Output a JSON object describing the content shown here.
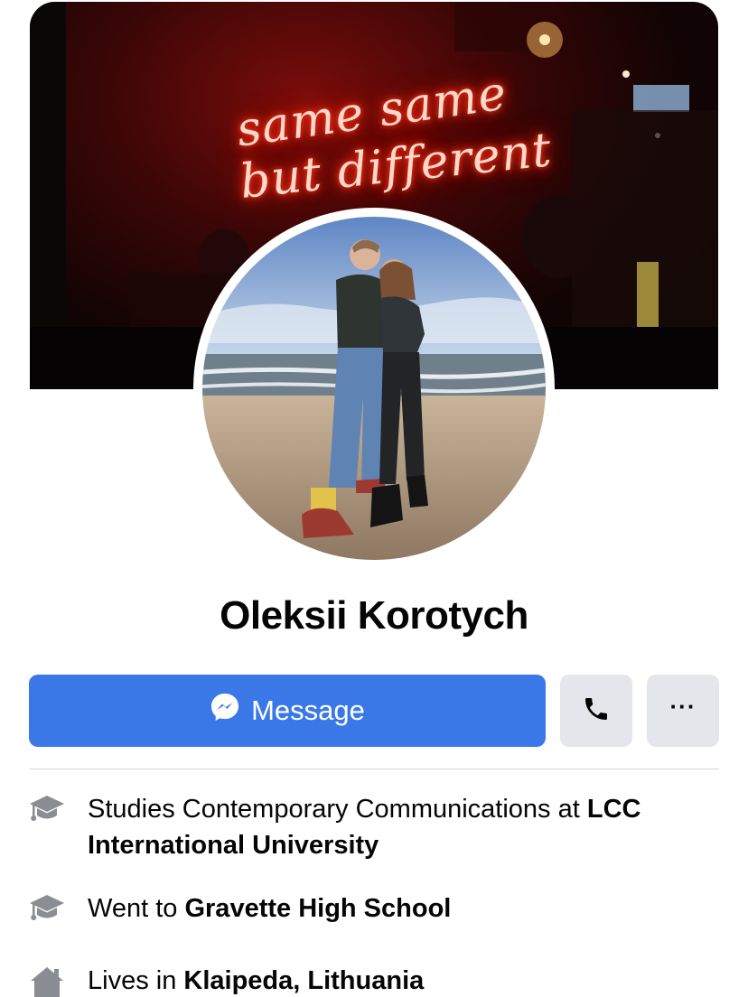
{
  "cover": {
    "neon_line_1": "same same",
    "neon_line_2": "but different"
  },
  "profile": {
    "name": "Oleksii Korotych"
  },
  "actions": {
    "message_label": "Message",
    "call_icon": "phone-icon",
    "more_icon": "more-icon",
    "more_label": "···"
  },
  "colors": {
    "primary": "#3b78e7",
    "secondary_button": "#e4e6eb",
    "icon_gray": "#8a8d91"
  },
  "info": [
    {
      "icon": "graduation-cap-icon",
      "prefix": "Studies Contemporary Communications at ",
      "bold": "LCC International University"
    },
    {
      "icon": "graduation-cap-icon",
      "prefix": "Went to ",
      "bold": "Gravette High School"
    },
    {
      "icon": "home-icon",
      "prefix": "Lives in ",
      "bold": "Klaipeda, Lithuania"
    }
  ]
}
